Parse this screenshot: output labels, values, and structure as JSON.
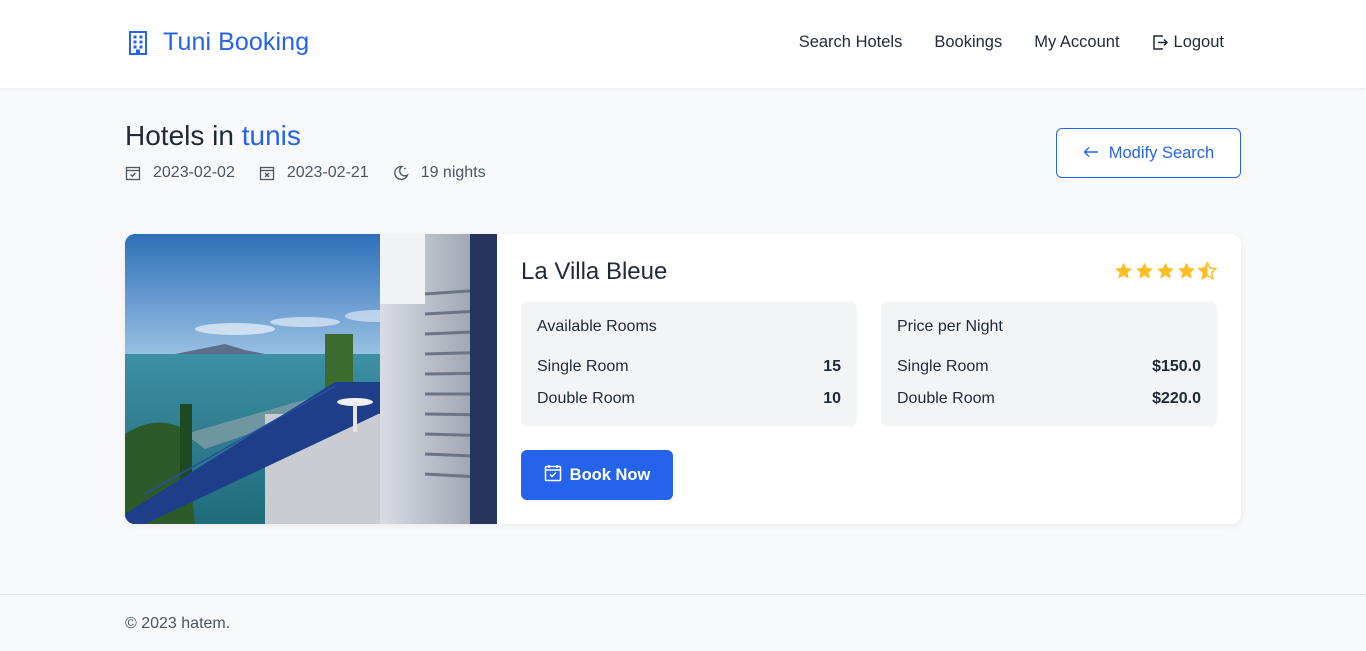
{
  "header": {
    "brand": "Tuni Booking",
    "nav": [
      "Search Hotels",
      "Bookings",
      "My Account",
      "Logout"
    ]
  },
  "page": {
    "title_prefix": "Hotels in ",
    "city": "tunis",
    "check_in": "2023-02-02",
    "check_out": "2023-02-21",
    "nights": "19 nights",
    "modify_search": "Modify Search"
  },
  "hotel": {
    "name": "La Villa Bleue",
    "rating": 4.5,
    "available_rooms": {
      "title": "Available Rooms",
      "rows": [
        {
          "label": "Single Room",
          "value": "15"
        },
        {
          "label": "Double Room",
          "value": "10"
        }
      ]
    },
    "price_per_night": {
      "title": "Price per Night",
      "rows": [
        {
          "label": "Single Room",
          "value": "$150.0"
        },
        {
          "label": "Double Room",
          "value": "$220.0"
        }
      ]
    },
    "book_now": "Book Now"
  },
  "footer": {
    "text": "© 2023 hatem."
  },
  "colors": {
    "accent": "#2563eb",
    "star": "#fbbf24",
    "background": "#f8f9fb"
  }
}
